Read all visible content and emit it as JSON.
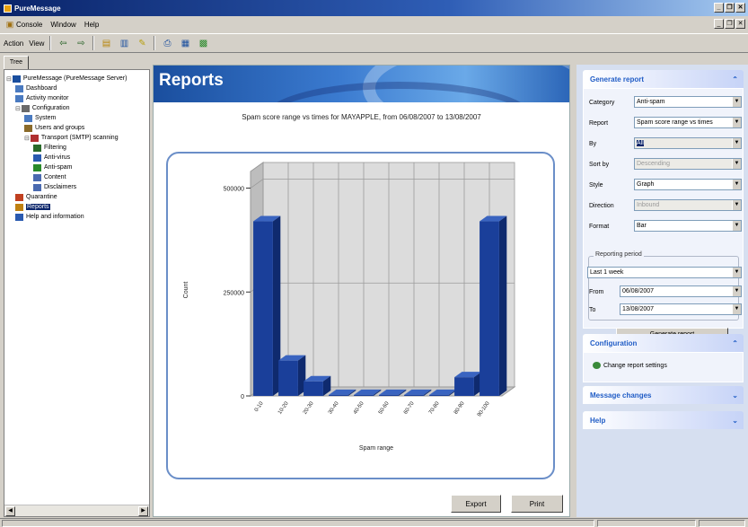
{
  "window": {
    "title": "PureMessage"
  },
  "menu": [
    "Console",
    "Window",
    "Help"
  ],
  "toolbar": {
    "action": "Action",
    "view": "View"
  },
  "tree": {
    "tab": "Tree",
    "items": [
      {
        "label": "PureMessage (PureMessage Server)",
        "level": 0,
        "icon": "server"
      },
      {
        "label": "Dashboard",
        "level": 1,
        "icon": "dashboard"
      },
      {
        "label": "Activity monitor",
        "level": 1,
        "icon": "monitor"
      },
      {
        "label": "Configuration",
        "level": 1,
        "icon": "config"
      },
      {
        "label": "System",
        "level": 2,
        "icon": "system"
      },
      {
        "label": "Users and groups",
        "level": 2,
        "icon": "users"
      },
      {
        "label": "Transport (SMTP) scanning",
        "level": 2,
        "icon": "transport"
      },
      {
        "label": "Filtering",
        "level": 3,
        "icon": "filter"
      },
      {
        "label": "Anti-virus",
        "level": 3,
        "icon": "antivirus"
      },
      {
        "label": "Anti-spam",
        "level": 3,
        "icon": "antispam"
      },
      {
        "label": "Content",
        "level": 3,
        "icon": "content"
      },
      {
        "label": "Disclaimers",
        "level": 3,
        "icon": "disclaimer"
      },
      {
        "label": "Quarantine",
        "level": 1,
        "icon": "quarantine"
      },
      {
        "label": "Reports",
        "level": 1,
        "icon": "reports"
      },
      {
        "label": "Help and information",
        "level": 1,
        "icon": "help"
      }
    ]
  },
  "main": {
    "title": "Reports",
    "chart_caption": "Spam score range vs times for MAYAPPLE, from 06/08/2007 to 13/08/2007",
    "export_label": "Export",
    "print_label": "Print"
  },
  "chart_data": {
    "type": "bar",
    "categories": [
      "0-10",
      "10-20",
      "20-30",
      "30-40",
      "40-50",
      "50-60",
      "60-70",
      "70-80",
      "80-90",
      "90-100"
    ],
    "values": [
      420000,
      85000,
      35000,
      0,
      0,
      0,
      0,
      0,
      45000,
      420000
    ],
    "ylabel": "Count",
    "xlabel": "Spam range",
    "yticks": [
      0,
      250000,
      500000
    ],
    "ylim": [
      0,
      540000
    ],
    "grid": true,
    "bar_color": "#1a3f9a"
  },
  "side": {
    "generate": {
      "title": "Generate report",
      "fields": [
        {
          "label": "Category",
          "value": "Anti-spam",
          "disabled": false
        },
        {
          "label": "Report",
          "value": "Spam score range vs times",
          "disabled": false
        },
        {
          "label": "By",
          "value": "All",
          "disabled": true
        },
        {
          "label": "Sort by",
          "value": "Descending",
          "disabled": true
        },
        {
          "label": "Style",
          "value": "Graph",
          "disabled": false
        },
        {
          "label": "Direction",
          "value": "Inbound",
          "disabled": true
        },
        {
          "label": "Format",
          "value": "Bar",
          "disabled": false
        }
      ],
      "period_label": "Reporting period",
      "period_value": "Last 1 week",
      "from_label": "From",
      "from_value": "06/08/2007",
      "to_label": "To",
      "to_value": "13/08/2007",
      "button": "Generate report"
    },
    "configuration": {
      "title": "Configuration",
      "link": "Change report settings"
    },
    "message_changes": {
      "title": "Message changes"
    },
    "help": {
      "title": "Help"
    }
  }
}
